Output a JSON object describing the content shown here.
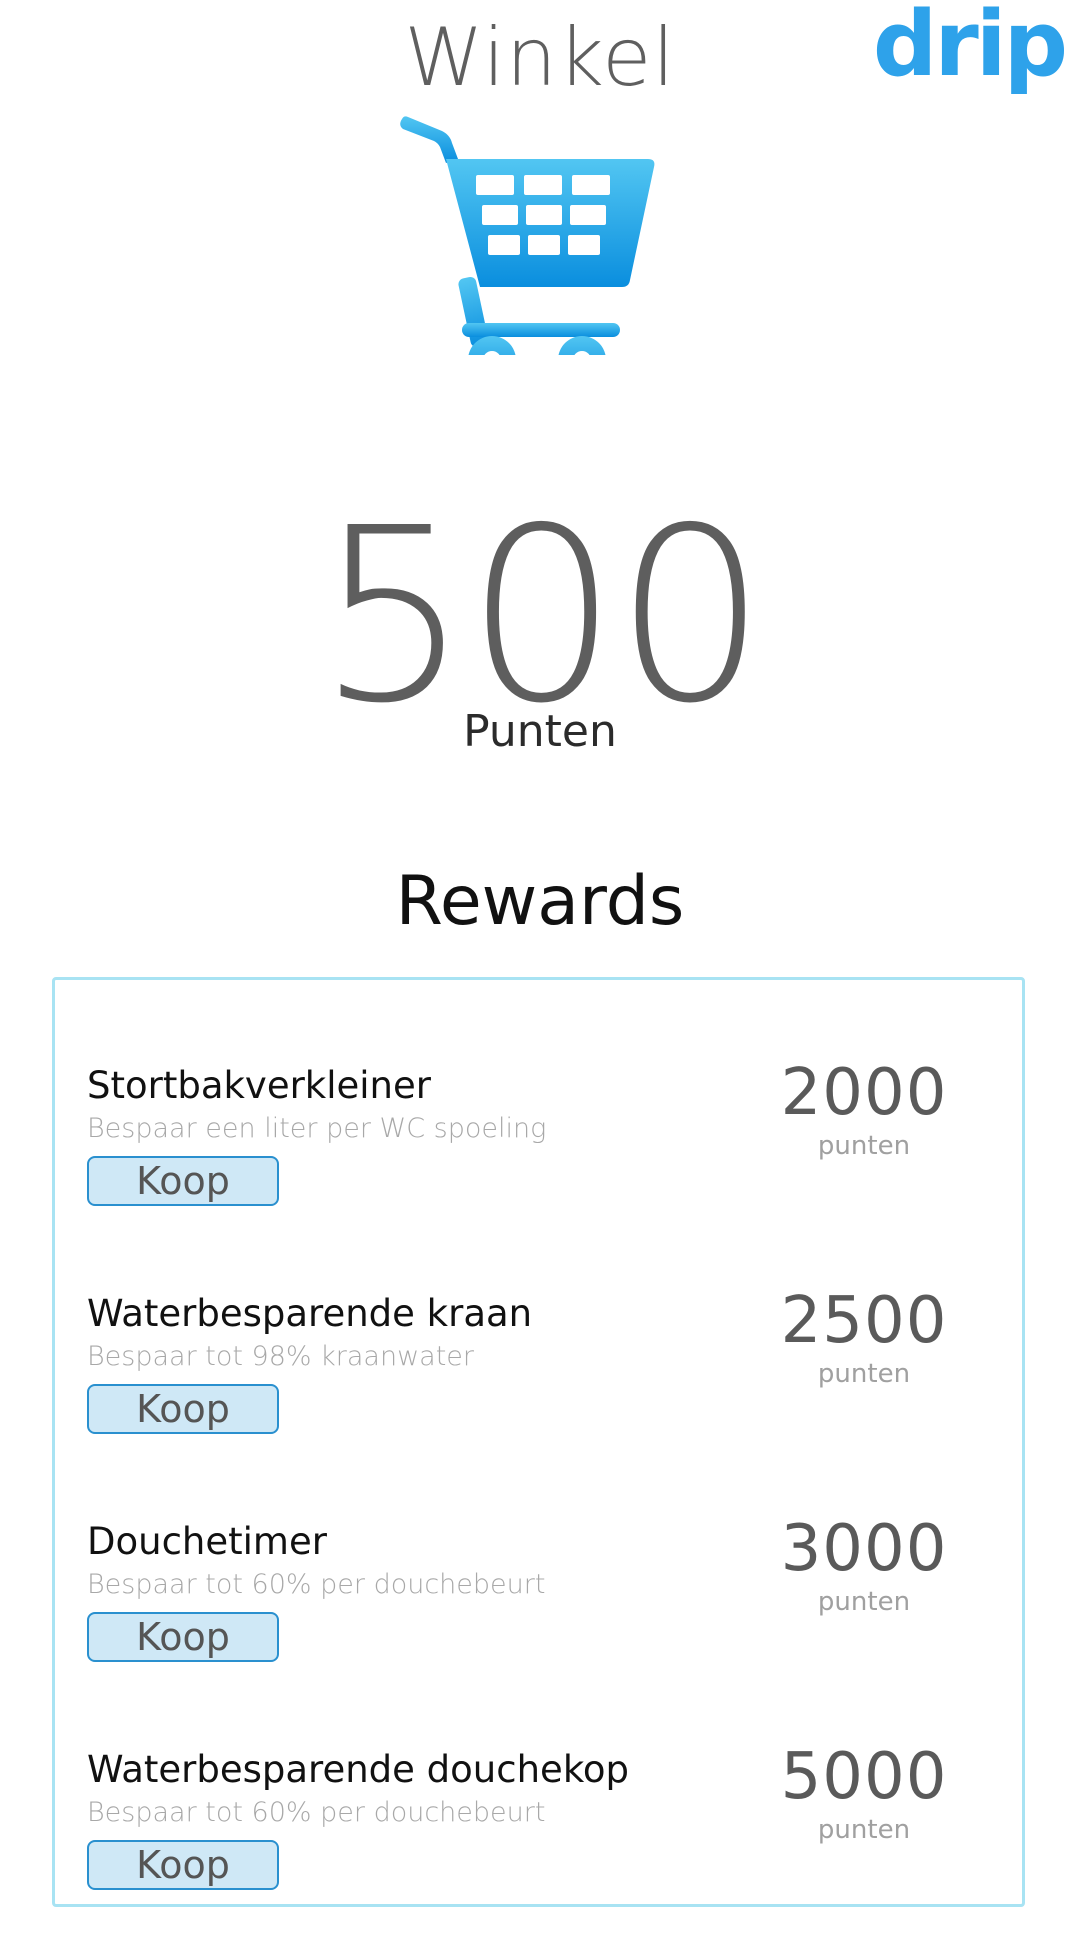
{
  "header": {
    "title": "Winkel",
    "brand": "drip",
    "cart_icon": "shopping-cart-icon",
    "accent_color": "#2ea2ea"
  },
  "points": {
    "value": "500",
    "unit": "Punten"
  },
  "rewards": {
    "title": "Rewards",
    "items": [
      {
        "name": "Stortbakverkleiner",
        "description": "Bespaar een liter per WC spoeling",
        "button_label": "Koop",
        "cost": "2000",
        "cost_unit": "punten"
      },
      {
        "name": "Waterbesparende kraan",
        "description": "Bespaar tot 98% kraanwater",
        "button_label": "Koop",
        "cost": "2500",
        "cost_unit": "punten"
      },
      {
        "name": "Douchetimer",
        "description": "Bespaar tot 60% per douchebeurt",
        "button_label": "Koop",
        "cost": "3000",
        "cost_unit": "punten"
      },
      {
        "name": "Waterbesparende douchekop",
        "description": "Bespaar tot 60% per douchebeurt",
        "button_label": "Koop",
        "cost": "5000",
        "cost_unit": "punten"
      }
    ]
  }
}
